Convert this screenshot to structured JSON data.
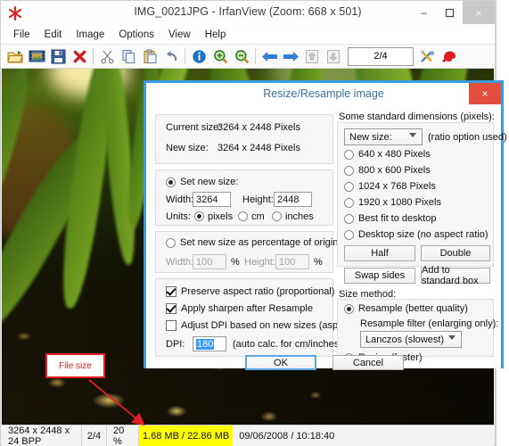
{
  "window": {
    "title": "IMG_0021JPG - IrfanView (Zoom: 668 x 501)",
    "logo_icon": "irfanview-logo-icon",
    "minimize_label": "–",
    "maximize_label": "❐",
    "close_label": "×"
  },
  "menu": {
    "items": [
      "File",
      "Edit",
      "Image",
      "Options",
      "View",
      "Help"
    ]
  },
  "toolbar": {
    "page_counter": "2/4",
    "buttons": [
      {
        "name": "open-folder-icon",
        "tip": "Open"
      },
      {
        "name": "thumbnails-icon",
        "tip": "Thumbnails"
      },
      {
        "name": "save-icon",
        "tip": "Save"
      },
      {
        "name": "delete-icon",
        "tip": "Delete"
      },
      {
        "name": "cut-icon",
        "tip": "Cut"
      },
      {
        "name": "copy-icon",
        "tip": "Copy"
      },
      {
        "name": "paste-icon",
        "tip": "Paste"
      },
      {
        "name": "undo-icon",
        "tip": "Undo"
      },
      {
        "name": "info-icon",
        "tip": "Information"
      },
      {
        "name": "zoom-in-icon",
        "tip": "Zoom in"
      },
      {
        "name": "zoom-out-icon",
        "tip": "Zoom out"
      },
      {
        "name": "previous-arrow-icon",
        "tip": "Previous"
      },
      {
        "name": "next-arrow-icon",
        "tip": "Next"
      },
      {
        "name": "first-image-icon",
        "tip": "First"
      },
      {
        "name": "last-image-icon",
        "tip": "Last"
      },
      {
        "name": "settings-tools-icon",
        "tip": "Options"
      },
      {
        "name": "paint-icon",
        "tip": "Paint"
      }
    ]
  },
  "status_bar": {
    "dimensions": "3264 x 2448 x 24 BPP",
    "page": "2/4",
    "zoom": "20 %",
    "file_size": "1.68 MB / 22.86 MB",
    "datetime": "09/06/2008 / 10:18:40"
  },
  "annotation": {
    "label": "File size",
    "border_color": "#e02020",
    "text_color": "#e02020"
  },
  "dialog": {
    "title": "Resize/Resample image",
    "close_label": "×",
    "close_bg": "#e2503d",
    "border_color": "#3c9ade",
    "info": {
      "current_size_label": "Current size:",
      "current_size_value": "3264  x  2448  Pixels",
      "new_size_label": "New size:",
      "new_size_value": "3264  x  2448  Pixels"
    },
    "set_new_size": {
      "radio_label": "Set new size:",
      "selected": true,
      "width_label": "Width:",
      "width_value": "3264",
      "height_label": "Height:",
      "height_value": "2448",
      "units_label": "Units:",
      "units": [
        {
          "label": "pixels",
          "selected": true
        },
        {
          "label": "cm",
          "selected": false
        },
        {
          "label": "inches",
          "selected": false
        }
      ]
    },
    "set_percentage": {
      "radio_label": "Set new size as percentage of original:",
      "selected": false,
      "width_label": "Width:",
      "width_value": "100",
      "width_unit": "%",
      "height_label": "Height:",
      "height_value": "100",
      "height_unit": "%"
    },
    "options": {
      "preserve_aspect": {
        "label": "Preserve aspect ratio (proportional)",
        "checked": true
      },
      "apply_sharpen": {
        "label": "Apply sharpen after Resample",
        "checked": true
      },
      "adjust_dpi": {
        "label": "Adjust DPI based on new sizes (asp. ratio)",
        "checked": false
      },
      "dpi_label": "DPI:",
      "dpi_value": "180",
      "dpi_hint": "(auto calc. for cm/inches)"
    },
    "standard_dimensions": {
      "group_label": "Some standard dimensions (pixels):",
      "dropdown_value": "New size:",
      "dropdown_note": "(ratio option used)",
      "radios": [
        {
          "label": "640 x 480 Pixels",
          "selected": false
        },
        {
          "label": "800 x 600 Pixels",
          "selected": false
        },
        {
          "label": "1024 x 768 Pixels",
          "selected": false
        },
        {
          "label": "1920 x 1080 Pixels",
          "selected": false
        },
        {
          "label": "Best fit to desktop",
          "selected": false
        },
        {
          "label": "Desktop size (no aspect ratio)",
          "selected": false
        }
      ],
      "half_label": "Half",
      "double_label": "Double",
      "swap_label": "Swap sides",
      "add_standard_label": "Add to standard box"
    },
    "size_method": {
      "group_label": "Size method:",
      "resample": {
        "label": "Resample (better quality)",
        "selected": true
      },
      "filter_label": "Resample filter (enlarging only):",
      "filter_value": "Lanczos (slowest)",
      "resize": {
        "label": "Resize (faster)",
        "selected": false
      }
    },
    "ok_label": "OK",
    "cancel_label": "Cancel"
  }
}
